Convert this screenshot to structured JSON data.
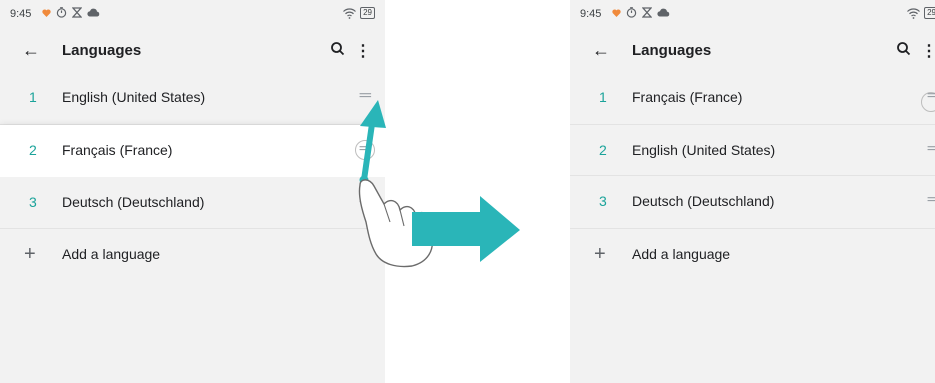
{
  "status": {
    "time": "9:45",
    "battery": "29"
  },
  "toolbar": {
    "back_icon": "←",
    "title": "Languages",
    "more_icon": "⋮"
  },
  "left": {
    "rows": [
      {
        "num": "1",
        "name": "English (United States)",
        "handle": "═"
      },
      {
        "num": "2",
        "name": "Français (France)",
        "handle": "═"
      },
      {
        "num": "3",
        "name": "Deutsch (Deutschland)",
        "handle": "═"
      }
    ],
    "add_label": "Add a language",
    "add_icon": "+"
  },
  "right": {
    "rows": [
      {
        "num": "1",
        "name": "Français (France)",
        "handle": "═"
      },
      {
        "num": "2",
        "name": "English (United States)",
        "handle": "═"
      },
      {
        "num": "3",
        "name": "Deutsch (Deutschland)",
        "handle": "═"
      }
    ],
    "add_label": "Add a language",
    "add_icon": "+"
  },
  "colors": {
    "accent": "#1aa39a",
    "arrow": "#2ab5b8",
    "background": "#f2f2f2"
  },
  "icons": [
    "back-arrow-icon",
    "search-icon",
    "more-vert-icon",
    "drag-handle-icon",
    "plus-icon",
    "wifi-icon",
    "battery-icon",
    "heart-icon",
    "timer-icon",
    "hourglass-icon",
    "cloud-icon",
    "hand-pointer-icon",
    "drag-up-arrow-icon",
    "right-arrow-icon"
  ]
}
